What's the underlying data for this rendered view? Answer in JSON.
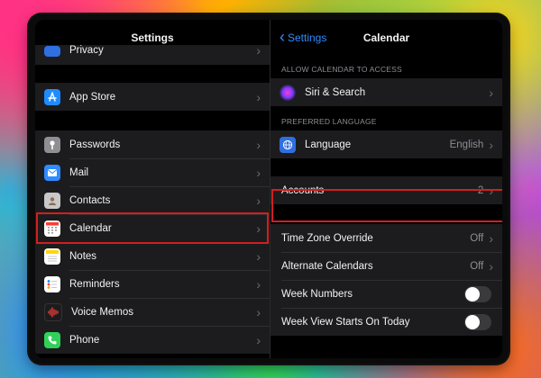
{
  "left": {
    "title": "Settings",
    "top_item": {
      "label": "Privacy"
    },
    "app_store": {
      "label": "App Store"
    },
    "items": [
      {
        "label": "Passwords",
        "icon": "key-icon",
        "color": "#8e8e93"
      },
      {
        "label": "Mail",
        "icon": "mail-icon",
        "color": "#2f8bff"
      },
      {
        "label": "Contacts",
        "icon": "contacts-icon",
        "color": "#b8b8b8"
      },
      {
        "label": "Calendar",
        "icon": "calendar-icon",
        "color": "#ffffff"
      },
      {
        "label": "Notes",
        "icon": "notes-icon",
        "color": "#ffd60a"
      },
      {
        "label": "Reminders",
        "icon": "reminders-icon",
        "color": "#ffffff"
      },
      {
        "label": "Voice Memos",
        "icon": "voice-memos-icon",
        "color": "#1c1c1e"
      },
      {
        "label": "Phone",
        "icon": "phone-icon",
        "color": "#30d158"
      }
    ]
  },
  "right": {
    "back_label": "Settings",
    "title": "Calendar",
    "section_access": "ALLOW CALENDAR TO ACCESS",
    "siri": {
      "label": "Siri & Search"
    },
    "section_language": "PREFERRED LANGUAGE",
    "language": {
      "label": "Language",
      "value": "English"
    },
    "accounts": {
      "label": "Accounts",
      "value": "2"
    },
    "timezone": {
      "label": "Time Zone Override",
      "value": "Off"
    },
    "alternate": {
      "label": "Alternate Calendars",
      "value": "Off"
    },
    "week_numbers": {
      "label": "Week Numbers",
      "on": false
    },
    "week_view": {
      "label": "Week View Starts On Today",
      "on": false
    }
  },
  "colors": {
    "accent": "#2f8bff",
    "highlight": "#d11f1f"
  }
}
